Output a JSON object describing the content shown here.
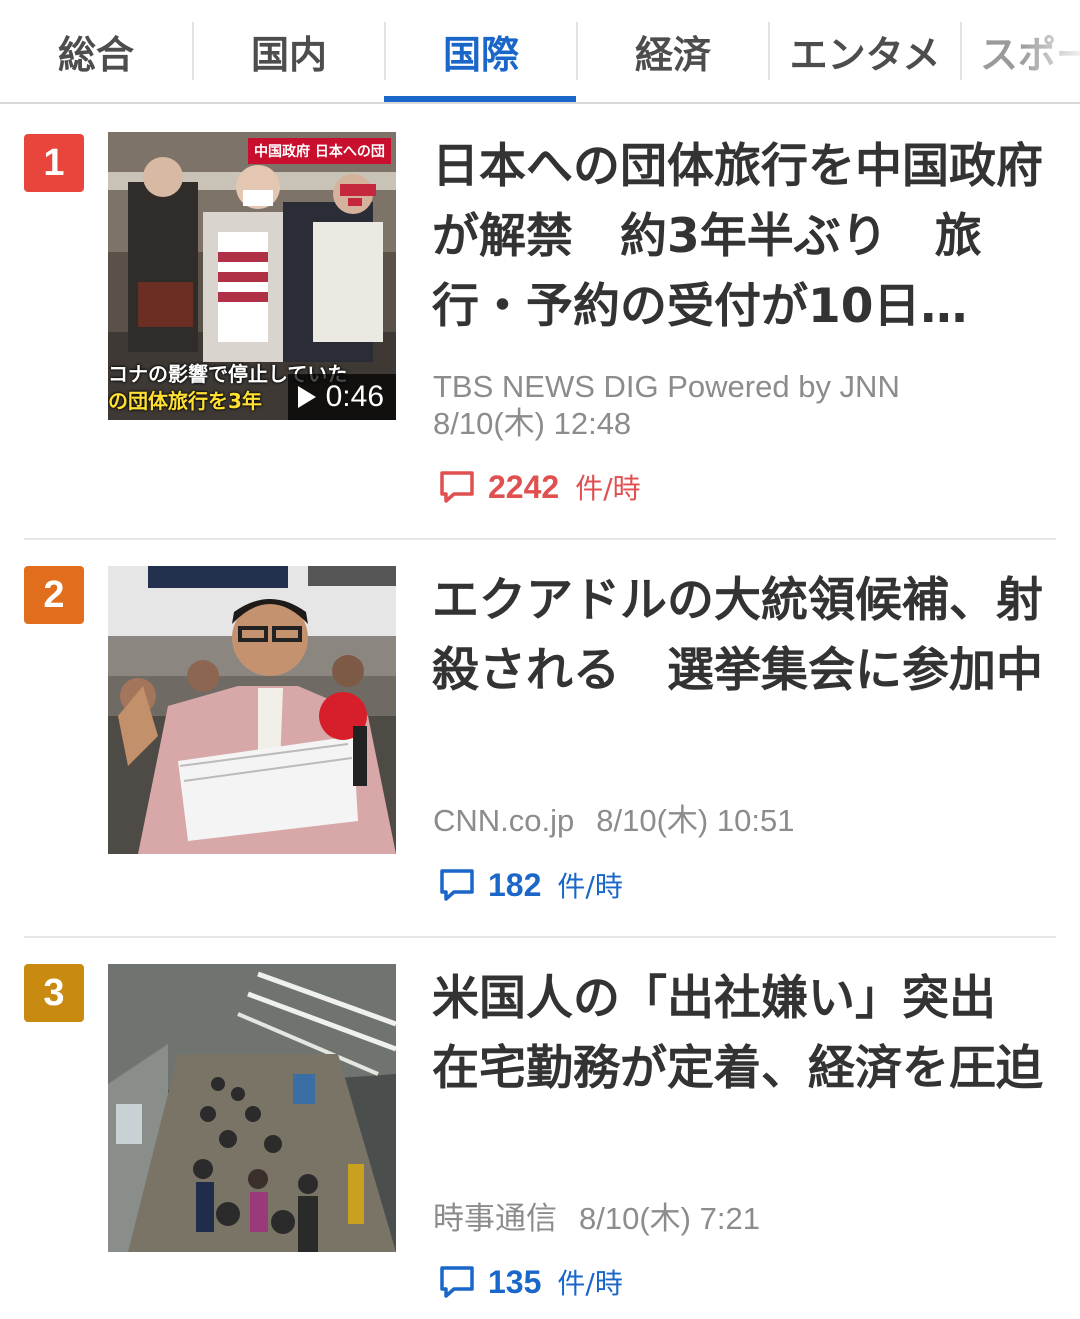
{
  "tabs": [
    {
      "label": "総合",
      "active": false
    },
    {
      "label": "国内",
      "active": false
    },
    {
      "label": "国際",
      "active": true
    },
    {
      "label": "経済",
      "active": false
    },
    {
      "label": "エンタメ",
      "active": false
    },
    {
      "label": "スポーツ",
      "active": false
    }
  ],
  "colors": {
    "accent": "#1a67c9",
    "rank1": "#e8453c",
    "rank2": "#e06e1c",
    "rank3": "#c98a12",
    "hot_comments": "#e05050",
    "comments": "#1a67c9"
  },
  "articles": [
    {
      "rank": "1",
      "headline": "日本への団体旅行を中国政府が解禁　約3年半ぶり　旅行・予約の受付が10日…",
      "source": "TBS NEWS DIG Powered by JNN",
      "datetime": "8/10(木) 12:48",
      "comment_count": "2242",
      "comment_unit": "件/時",
      "thumbnail": {
        "type": "video",
        "duration": "0:46",
        "caption_line1": "コナの影響で停止していた",
        "caption_line2": "の団体旅行を3年",
        "breaking_text": "中国政府 日本への団"
      }
    },
    {
      "rank": "2",
      "headline": "エクアドルの大統領候補、射殺される　選挙集会に参加中",
      "source": "CNN.co.jp",
      "datetime": "8/10(木) 10:51",
      "comment_count": "182",
      "comment_unit": "件/時",
      "thumbnail": {
        "type": "photo"
      }
    },
    {
      "rank": "3",
      "headline": "米国人の「出社嫌い」突出　在宅勤務が定着、経済を圧迫",
      "source": "時事通信",
      "datetime": "8/10(木) 7:21",
      "comment_count": "135",
      "comment_unit": "件/時",
      "thumbnail": {
        "type": "photo"
      }
    }
  ]
}
